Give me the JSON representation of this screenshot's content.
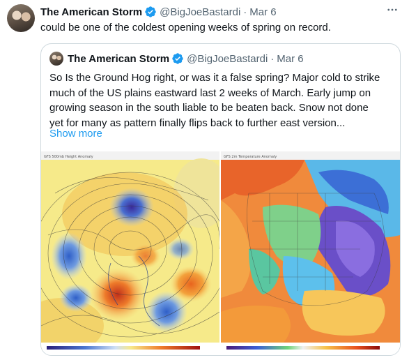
{
  "tweet": {
    "author_name": "The American Storm",
    "handle": "@BigJoeBastardi",
    "separator": "·",
    "date": "Mar 6",
    "more_icon": "ellipsis-icon",
    "text": "could be one of the coldest opening weeks of spring on record."
  },
  "quote": {
    "author_name": "The American Storm",
    "handle": "@BigJoeBastardi",
    "separator": "·",
    "date": "Mar 6",
    "lines": [
      "So Is the Ground Hog right, or was it a false spring?  Major cold to strike",
      "much of the US plains eastward last 2 weeks of March.  Early jump on",
      "growing season in the south liable to be beaten back. Snow not done",
      "yet for many as pattern finally flips back to further east version..."
    ],
    "show_more": "Show more"
  },
  "colors": {
    "accent": "#1d9bf0",
    "text_primary": "#0f1419",
    "text_secondary": "#536471",
    "border": "#cfd9de"
  }
}
